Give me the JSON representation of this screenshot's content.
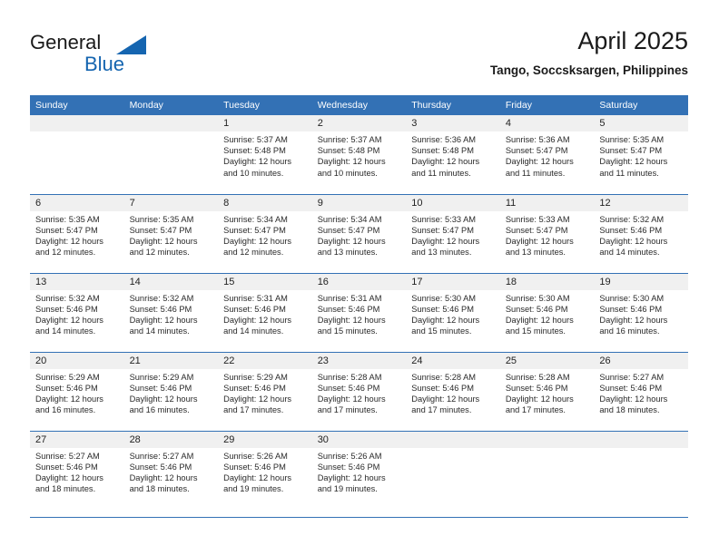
{
  "logo": {
    "word_top": "General",
    "word_bottom": "Blue",
    "triangle_color": "#1565b0",
    "text_color": "#1a1a1a"
  },
  "header": {
    "title": "April 2025",
    "subtitle": "Tango, Soccsksargen, Philippines"
  },
  "theme": {
    "header_blue": "#3371b5",
    "daynum_gray": "#f0f0f0",
    "text": "#222222"
  },
  "weekday_headers": [
    "Sunday",
    "Monday",
    "Tuesday",
    "Wednesday",
    "Thursday",
    "Friday",
    "Saturday"
  ],
  "weeks": [
    [
      {
        "day": "",
        "sunrise": "",
        "sunset": "",
        "daylight_line1": "",
        "daylight_line2": ""
      },
      {
        "day": "",
        "sunrise": "",
        "sunset": "",
        "daylight_line1": "",
        "daylight_line2": ""
      },
      {
        "day": "1",
        "sunrise": "Sunrise: 5:37 AM",
        "sunset": "Sunset: 5:48 PM",
        "daylight_line1": "Daylight: 12 hours",
        "daylight_line2": "and 10 minutes."
      },
      {
        "day": "2",
        "sunrise": "Sunrise: 5:37 AM",
        "sunset": "Sunset: 5:48 PM",
        "daylight_line1": "Daylight: 12 hours",
        "daylight_line2": "and 10 minutes."
      },
      {
        "day": "3",
        "sunrise": "Sunrise: 5:36 AM",
        "sunset": "Sunset: 5:48 PM",
        "daylight_line1": "Daylight: 12 hours",
        "daylight_line2": "and 11 minutes."
      },
      {
        "day": "4",
        "sunrise": "Sunrise: 5:36 AM",
        "sunset": "Sunset: 5:47 PM",
        "daylight_line1": "Daylight: 12 hours",
        "daylight_line2": "and 11 minutes."
      },
      {
        "day": "5",
        "sunrise": "Sunrise: 5:35 AM",
        "sunset": "Sunset: 5:47 PM",
        "daylight_line1": "Daylight: 12 hours",
        "daylight_line2": "and 11 minutes."
      }
    ],
    [
      {
        "day": "6",
        "sunrise": "Sunrise: 5:35 AM",
        "sunset": "Sunset: 5:47 PM",
        "daylight_line1": "Daylight: 12 hours",
        "daylight_line2": "and 12 minutes."
      },
      {
        "day": "7",
        "sunrise": "Sunrise: 5:35 AM",
        "sunset": "Sunset: 5:47 PM",
        "daylight_line1": "Daylight: 12 hours",
        "daylight_line2": "and 12 minutes."
      },
      {
        "day": "8",
        "sunrise": "Sunrise: 5:34 AM",
        "sunset": "Sunset: 5:47 PM",
        "daylight_line1": "Daylight: 12 hours",
        "daylight_line2": "and 12 minutes."
      },
      {
        "day": "9",
        "sunrise": "Sunrise: 5:34 AM",
        "sunset": "Sunset: 5:47 PM",
        "daylight_line1": "Daylight: 12 hours",
        "daylight_line2": "and 13 minutes."
      },
      {
        "day": "10",
        "sunrise": "Sunrise: 5:33 AM",
        "sunset": "Sunset: 5:47 PM",
        "daylight_line1": "Daylight: 12 hours",
        "daylight_line2": "and 13 minutes."
      },
      {
        "day": "11",
        "sunrise": "Sunrise: 5:33 AM",
        "sunset": "Sunset: 5:47 PM",
        "daylight_line1": "Daylight: 12 hours",
        "daylight_line2": "and 13 minutes."
      },
      {
        "day": "12",
        "sunrise": "Sunrise: 5:32 AM",
        "sunset": "Sunset: 5:46 PM",
        "daylight_line1": "Daylight: 12 hours",
        "daylight_line2": "and 14 minutes."
      }
    ],
    [
      {
        "day": "13",
        "sunrise": "Sunrise: 5:32 AM",
        "sunset": "Sunset: 5:46 PM",
        "daylight_line1": "Daylight: 12 hours",
        "daylight_line2": "and 14 minutes."
      },
      {
        "day": "14",
        "sunrise": "Sunrise: 5:32 AM",
        "sunset": "Sunset: 5:46 PM",
        "daylight_line1": "Daylight: 12 hours",
        "daylight_line2": "and 14 minutes."
      },
      {
        "day": "15",
        "sunrise": "Sunrise: 5:31 AM",
        "sunset": "Sunset: 5:46 PM",
        "daylight_line1": "Daylight: 12 hours",
        "daylight_line2": "and 14 minutes."
      },
      {
        "day": "16",
        "sunrise": "Sunrise: 5:31 AM",
        "sunset": "Sunset: 5:46 PM",
        "daylight_line1": "Daylight: 12 hours",
        "daylight_line2": "and 15 minutes."
      },
      {
        "day": "17",
        "sunrise": "Sunrise: 5:30 AM",
        "sunset": "Sunset: 5:46 PM",
        "daylight_line1": "Daylight: 12 hours",
        "daylight_line2": "and 15 minutes."
      },
      {
        "day": "18",
        "sunrise": "Sunrise: 5:30 AM",
        "sunset": "Sunset: 5:46 PM",
        "daylight_line1": "Daylight: 12 hours",
        "daylight_line2": "and 15 minutes."
      },
      {
        "day": "19",
        "sunrise": "Sunrise: 5:30 AM",
        "sunset": "Sunset: 5:46 PM",
        "daylight_line1": "Daylight: 12 hours",
        "daylight_line2": "and 16 minutes."
      }
    ],
    [
      {
        "day": "20",
        "sunrise": "Sunrise: 5:29 AM",
        "sunset": "Sunset: 5:46 PM",
        "daylight_line1": "Daylight: 12 hours",
        "daylight_line2": "and 16 minutes."
      },
      {
        "day": "21",
        "sunrise": "Sunrise: 5:29 AM",
        "sunset": "Sunset: 5:46 PM",
        "daylight_line1": "Daylight: 12 hours",
        "daylight_line2": "and 16 minutes."
      },
      {
        "day": "22",
        "sunrise": "Sunrise: 5:29 AM",
        "sunset": "Sunset: 5:46 PM",
        "daylight_line1": "Daylight: 12 hours",
        "daylight_line2": "and 17 minutes."
      },
      {
        "day": "23",
        "sunrise": "Sunrise: 5:28 AM",
        "sunset": "Sunset: 5:46 PM",
        "daylight_line1": "Daylight: 12 hours",
        "daylight_line2": "and 17 minutes."
      },
      {
        "day": "24",
        "sunrise": "Sunrise: 5:28 AM",
        "sunset": "Sunset: 5:46 PM",
        "daylight_line1": "Daylight: 12 hours",
        "daylight_line2": "and 17 minutes."
      },
      {
        "day": "25",
        "sunrise": "Sunrise: 5:28 AM",
        "sunset": "Sunset: 5:46 PM",
        "daylight_line1": "Daylight: 12 hours",
        "daylight_line2": "and 17 minutes."
      },
      {
        "day": "26",
        "sunrise": "Sunrise: 5:27 AM",
        "sunset": "Sunset: 5:46 PM",
        "daylight_line1": "Daylight: 12 hours",
        "daylight_line2": "and 18 minutes."
      }
    ],
    [
      {
        "day": "27",
        "sunrise": "Sunrise: 5:27 AM",
        "sunset": "Sunset: 5:46 PM",
        "daylight_line1": "Daylight: 12 hours",
        "daylight_line2": "and 18 minutes."
      },
      {
        "day": "28",
        "sunrise": "Sunrise: 5:27 AM",
        "sunset": "Sunset: 5:46 PM",
        "daylight_line1": "Daylight: 12 hours",
        "daylight_line2": "and 18 minutes."
      },
      {
        "day": "29",
        "sunrise": "Sunrise: 5:26 AM",
        "sunset": "Sunset: 5:46 PM",
        "daylight_line1": "Daylight: 12 hours",
        "daylight_line2": "and 19 minutes."
      },
      {
        "day": "30",
        "sunrise": "Sunrise: 5:26 AM",
        "sunset": "Sunset: 5:46 PM",
        "daylight_line1": "Daylight: 12 hours",
        "daylight_line2": "and 19 minutes."
      },
      {
        "day": "",
        "sunrise": "",
        "sunset": "",
        "daylight_line1": "",
        "daylight_line2": ""
      },
      {
        "day": "",
        "sunrise": "",
        "sunset": "",
        "daylight_line1": "",
        "daylight_line2": ""
      },
      {
        "day": "",
        "sunrise": "",
        "sunset": "",
        "daylight_line1": "",
        "daylight_line2": ""
      }
    ]
  ]
}
